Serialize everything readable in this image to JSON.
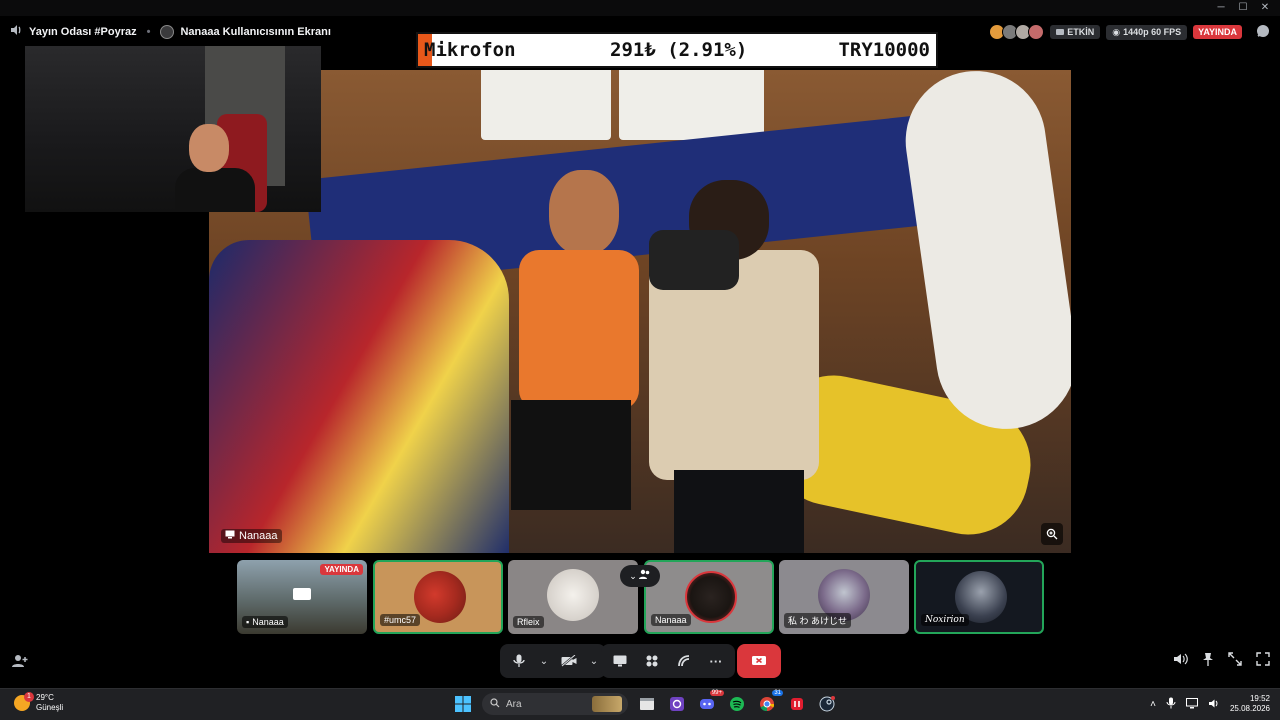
{
  "window": {
    "controls": [
      "─",
      "☐",
      "✕"
    ]
  },
  "header": {
    "channel": "Yayın Odası #Poyraz",
    "screen_title": "Nanaaa Kullanıcısının Ekranı",
    "activity_label": "ETKİN",
    "stream_quality": "1440p 60 FPS",
    "live_label": "YAYINDA"
  },
  "overlay": {
    "item": "Mikrofon",
    "progress": "291₺ (2.91%)",
    "goal": "TRY10000",
    "progress_fraction": 0.0291
  },
  "stream": {
    "streamer_label": "Nanaaa"
  },
  "participants": [
    {
      "name": "Nanaaa",
      "badge": "YAYINDA",
      "border": "none"
    },
    {
      "name": "#umc57",
      "border": "#23a559"
    },
    {
      "name": "Rfleix",
      "border": "none"
    },
    {
      "name": "Nanaaa",
      "border": "#23a559"
    },
    {
      "name": "私 わ あけじせ",
      "border": "none"
    },
    {
      "name": "Noxirion",
      "border": "#23a559"
    }
  ],
  "taskbar": {
    "weather_temp": "29°C",
    "weather_desc": "Güneşli",
    "search_placeholder": "Ara",
    "time": "19:52",
    "date": "25.08.2026",
    "notif_badge": "1",
    "discord_badge": "99+",
    "chrome_badge": "31"
  },
  "colors": {
    "live": "#da373c",
    "speaking": "#23a559",
    "bg": "#000000",
    "control_bg": "#1e1f22"
  }
}
